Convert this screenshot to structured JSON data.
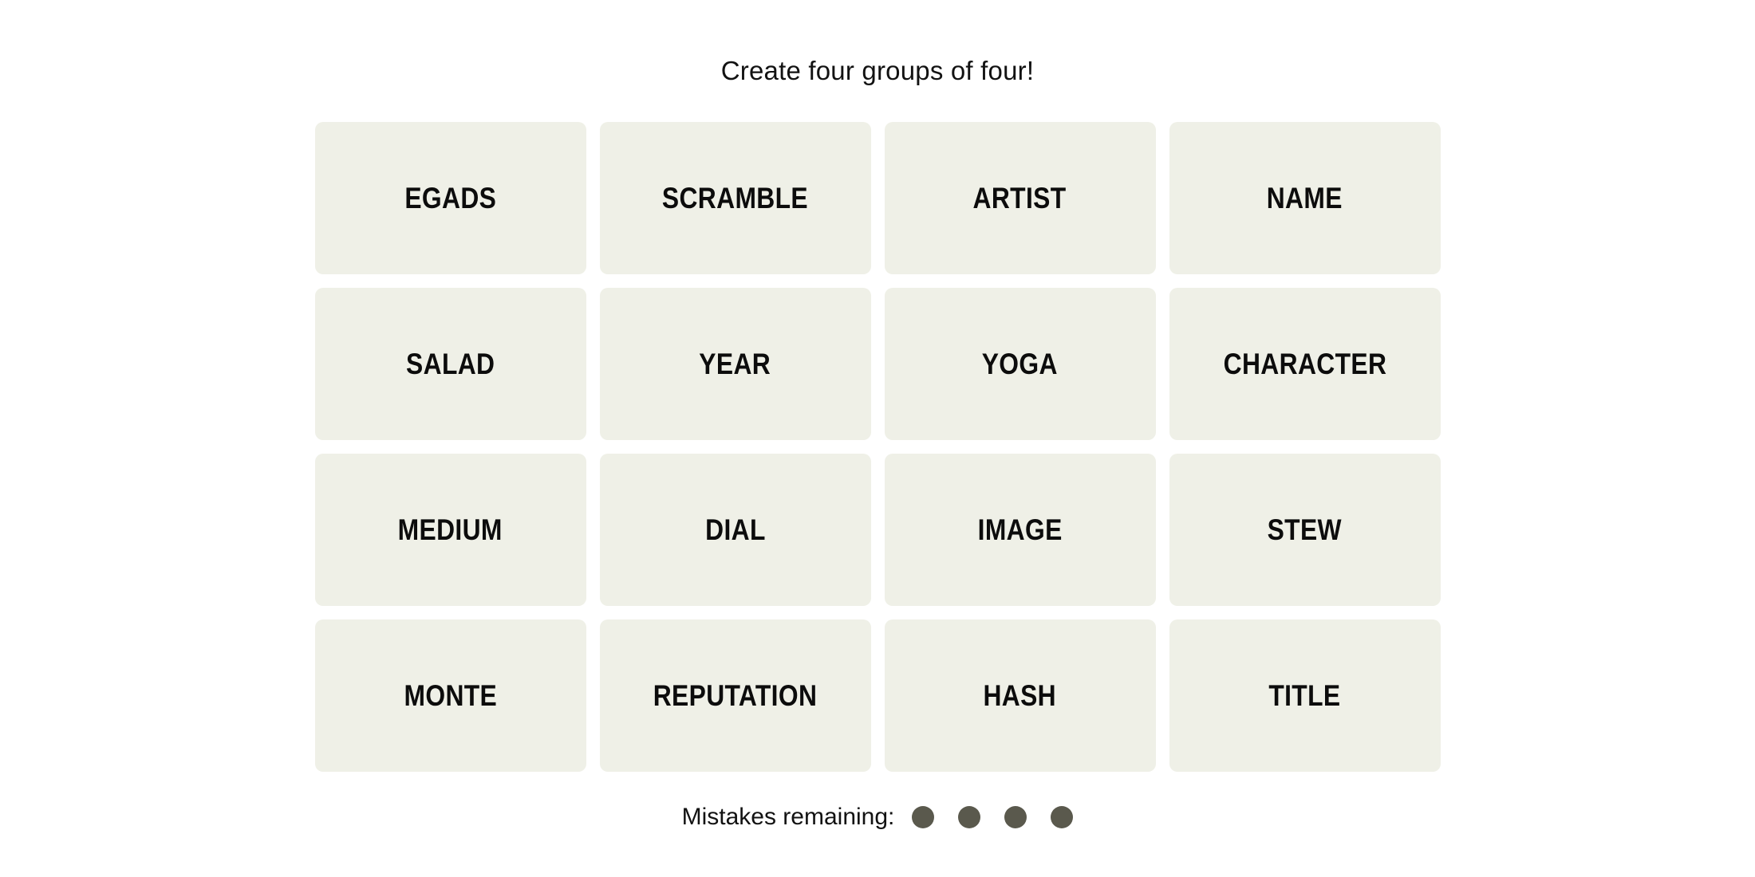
{
  "game": {
    "title": "Create four groups of four!",
    "board": {
      "rows": [
        [
          "EGADS",
          "SCRAMBLE",
          "ARTIST",
          "NAME"
        ],
        [
          "SALAD",
          "YEAR",
          "YOGA",
          "CHARACTER"
        ],
        [
          "MEDIUM",
          "DIAL",
          "IMAGE",
          "STEW"
        ],
        [
          "MONTE",
          "REPUTATION",
          "HASH",
          "TITLE"
        ]
      ]
    },
    "footer": {
      "mistakes_label": "Mistakes remaining:",
      "mistakes_remaining": 4,
      "dots": [
        "mistake-dot",
        "mistake-dot",
        "mistake-dot",
        "mistake-dot"
      ]
    },
    "colors": {
      "page_background": "#ffffff",
      "tile_background": "#eff0e7",
      "tile_text": "#0c0c0c",
      "title_text": "#121212",
      "dot_fill": "#5a594d"
    }
  }
}
